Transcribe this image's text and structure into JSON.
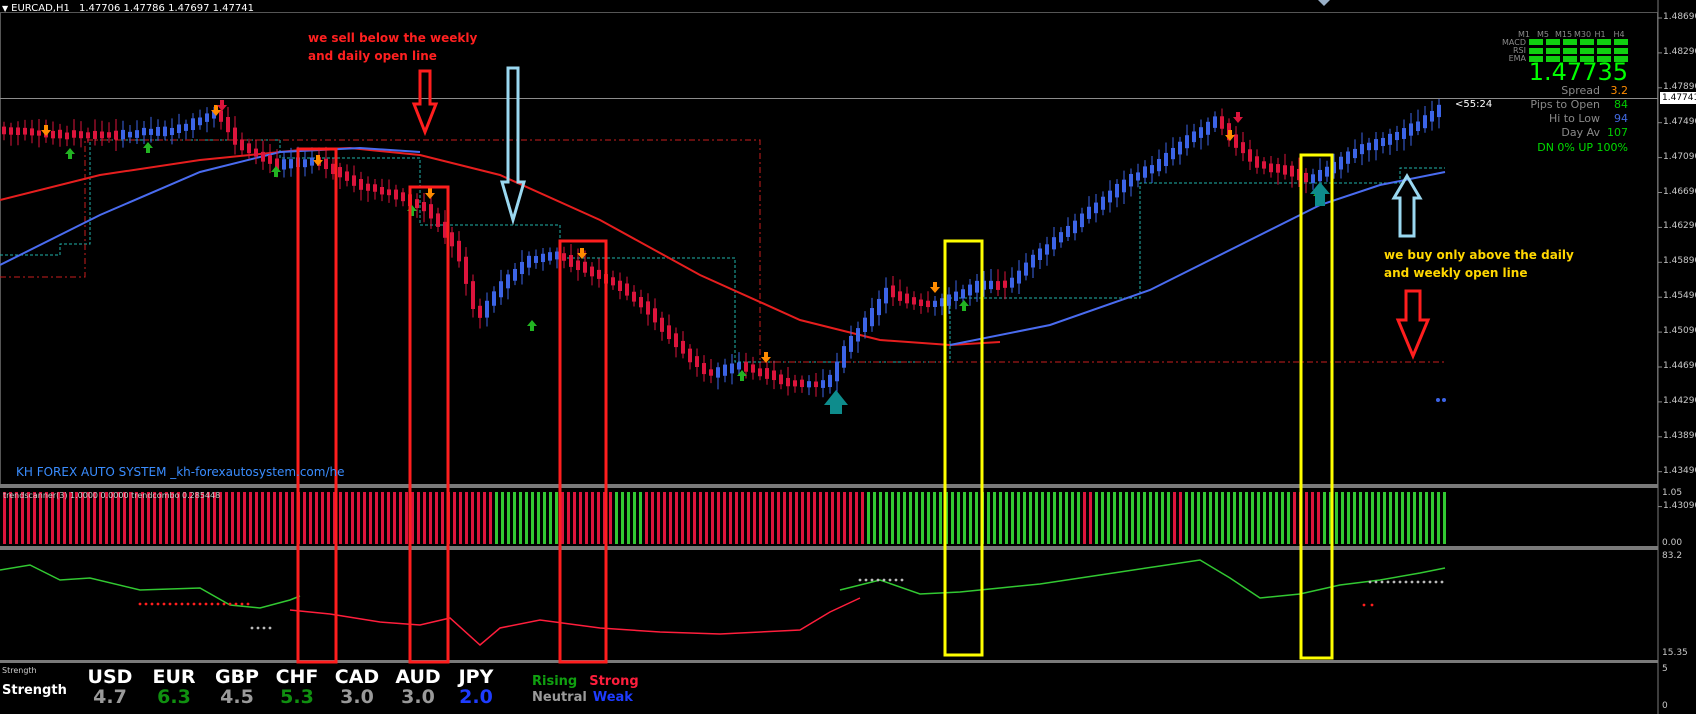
{
  "header": {
    "symbol": "EURCAD,H1",
    "ohlc": "1.47706 1.47786 1.47697 1.47741"
  },
  "price_axis": {
    "labels": [
      "1.48690",
      "1.48290",
      "1.47890",
      "1.47490",
      "1.47090",
      "1.46690",
      "1.46290",
      "1.45890",
      "1.45490",
      "1.45090",
      "1.44690",
      "1.44290",
      "1.43890",
      "1.43490",
      "1.43090"
    ],
    "current_price_tag": "1.47741",
    "countdown": "<55:24"
  },
  "annotations": {
    "sell_line1": "we sell below the weekly",
    "sell_line2": "and daily  open line",
    "buy_line1": "we buy only above the daily",
    "buy_line2": "and weekly open line",
    "watermark": "KH FOREX AUTO SYSTEM _kh-forexautosystem.com/he"
  },
  "info_panel": {
    "timeframes": [
      "M1",
      "M5",
      "M15",
      "M30",
      "H1",
      "H4"
    ],
    "indicators": [
      "MACD",
      "RSI",
      "EMA"
    ],
    "price": "1.47735",
    "rows": [
      {
        "label": "Spread",
        "value": "3.2",
        "color": "#ff8c00"
      },
      {
        "label": "Pips to Open",
        "value": "84",
        "color": "#00cc00"
      },
      {
        "label": "Hi to Low",
        "value": "94",
        "color": "#4169e1"
      },
      {
        "label": "Day Av",
        "value": "107",
        "color": "#00cc00"
      }
    ],
    "dn_up": "DN 0%  UP 100%"
  },
  "sub1": {
    "label": "trendscanner(3) 1.0000 0.0000  trendcombo 0.285448",
    "axis_top": "1.05",
    "axis_bottom": "0.00"
  },
  "sub2": {
    "axis_top": "83.2",
    "axis_bottom": "15.35"
  },
  "strength": {
    "panel_label": "Strength",
    "row_label": "Strength",
    "currencies": [
      {
        "name": "USD",
        "value": "4.7",
        "color": "#9a9a9a"
      },
      {
        "name": "EUR",
        "value": "6.3",
        "color": "#109010"
      },
      {
        "name": "GBP",
        "value": "4.5",
        "color": "#9a9a9a"
      },
      {
        "name": "CHF",
        "value": "5.3",
        "color": "#109010"
      },
      {
        "name": "CAD",
        "value": "3.0",
        "color": "#9a9a9a"
      },
      {
        "name": "AUD",
        "value": "3.0",
        "color": "#9a9a9a"
      },
      {
        "name": "JPY",
        "value": "2.0",
        "color": "#1e3cff"
      }
    ],
    "legend": {
      "rising": "Rising",
      "strong": "Strong",
      "neutral": "Neutral",
      "weak": "Weak"
    },
    "axis_top": "5",
    "axis_bottom": "0"
  },
  "colors": {
    "bull": "#3c64e6",
    "bear": "#dc143c",
    "ma_red": "#e61e1e",
    "ma_blue": "#4a6cf0",
    "open_line_cyan": "#20b2aa",
    "open_line_red": "#c81e1e",
    "box_red": "#ff1e1e",
    "box_yellow": "#ffff00"
  }
}
